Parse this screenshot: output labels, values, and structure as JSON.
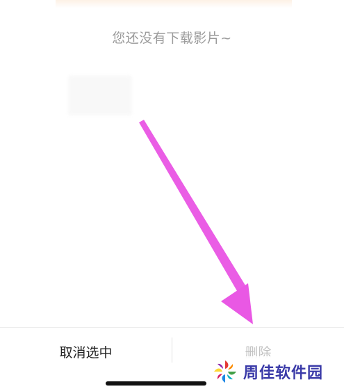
{
  "empty_state": {
    "message": "您还没有下载影片~"
  },
  "bottom_bar": {
    "cancel_label": "取消选中",
    "delete_label": "删除"
  },
  "watermark": {
    "text": "周佳软件园"
  },
  "colors": {
    "arrow": "#e84fe3",
    "delete_disabled": "#c2c2c2",
    "empty_text": "#9a9a9a",
    "watermark_text": "#3a3aa8"
  }
}
